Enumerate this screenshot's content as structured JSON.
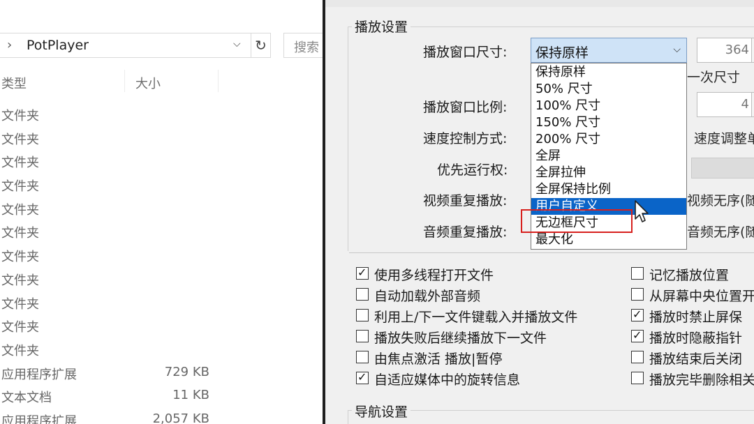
{
  "explorer": {
    "address_path": "PotPlayer",
    "search_placeholder": "搜索",
    "columns": {
      "type": "类型",
      "size": "大小"
    },
    "rows": [
      {
        "type": "文件夹",
        "size": ""
      },
      {
        "type": "文件夹",
        "size": ""
      },
      {
        "type": "文件夹",
        "size": ""
      },
      {
        "type": "文件夹",
        "size": ""
      },
      {
        "type": "文件夹",
        "size": ""
      },
      {
        "type": "文件夹",
        "size": ""
      },
      {
        "type": "文件夹",
        "size": ""
      },
      {
        "type": "文件夹",
        "size": ""
      },
      {
        "type": "文件夹",
        "size": ""
      },
      {
        "type": "文件夹",
        "size": ""
      },
      {
        "type": "文件夹",
        "size": ""
      },
      {
        "type": "应用程序扩展",
        "size": "729 KB"
      },
      {
        "type": "文本文档",
        "size": "11 KB"
      },
      {
        "type": "应用程序扩展",
        "size": "2,057 KB"
      }
    ]
  },
  "dialog": {
    "group_title": "播放设置",
    "labels": {
      "window_size": "播放窗口尺寸:",
      "window_ratio": "播放窗口比例:",
      "speed_control": "速度控制方式:",
      "priority": "优先运行权:",
      "video_repeat": "视频重复播放:",
      "audio_repeat": "音频重复播放:"
    },
    "window_size_selected": "保持原样",
    "window_size_options": [
      "保持原样",
      "50% 尺寸",
      "100% 尺寸",
      "150% 尺寸",
      "200% 尺寸",
      "全屏",
      "全屏拉伸",
      "全屏保持比例",
      "用户自定义",
      "无边框尺寸",
      "最大化"
    ],
    "hovered_option_index": 8,
    "spin_width": "364",
    "spin_ratio": "4",
    "side_texts": {
      "next_size": "一次尺寸",
      "speed_adjust": "速度调整单",
      "video_shuffle": "视频无序(随",
      "audio_shuffle": "音频无序(随"
    },
    "checkboxes_left": [
      {
        "label": "使用多线程打开文件",
        "checked": true
      },
      {
        "label": "自动加载外部音频",
        "checked": false
      },
      {
        "label": "利用上/下一文件键载入并播放文件",
        "checked": false
      },
      {
        "label": "播放失败后继续播放下一文件",
        "checked": false
      },
      {
        "label": "由焦点激活 播放|暂停",
        "checked": false
      },
      {
        "label": "自适应媒体中的旋转信息",
        "checked": true
      }
    ],
    "checkboxes_right": [
      {
        "label": "记忆播放位置",
        "checked": false
      },
      {
        "label": "从屏幕中央位置开",
        "checked": false
      },
      {
        "label": "播放时禁止屏保",
        "checked": true
      },
      {
        "label": "播放时隐蔽指针",
        "checked": true
      },
      {
        "label": "播放结束后关闭",
        "checked": false
      },
      {
        "label": "播放完毕删除相关",
        "checked": false
      }
    ],
    "nav_group_title": "导航设置"
  },
  "colors": {
    "selection": "#0a64c8",
    "highlight_box": "#d7201d",
    "combo_focus": "#cfe3f7"
  }
}
